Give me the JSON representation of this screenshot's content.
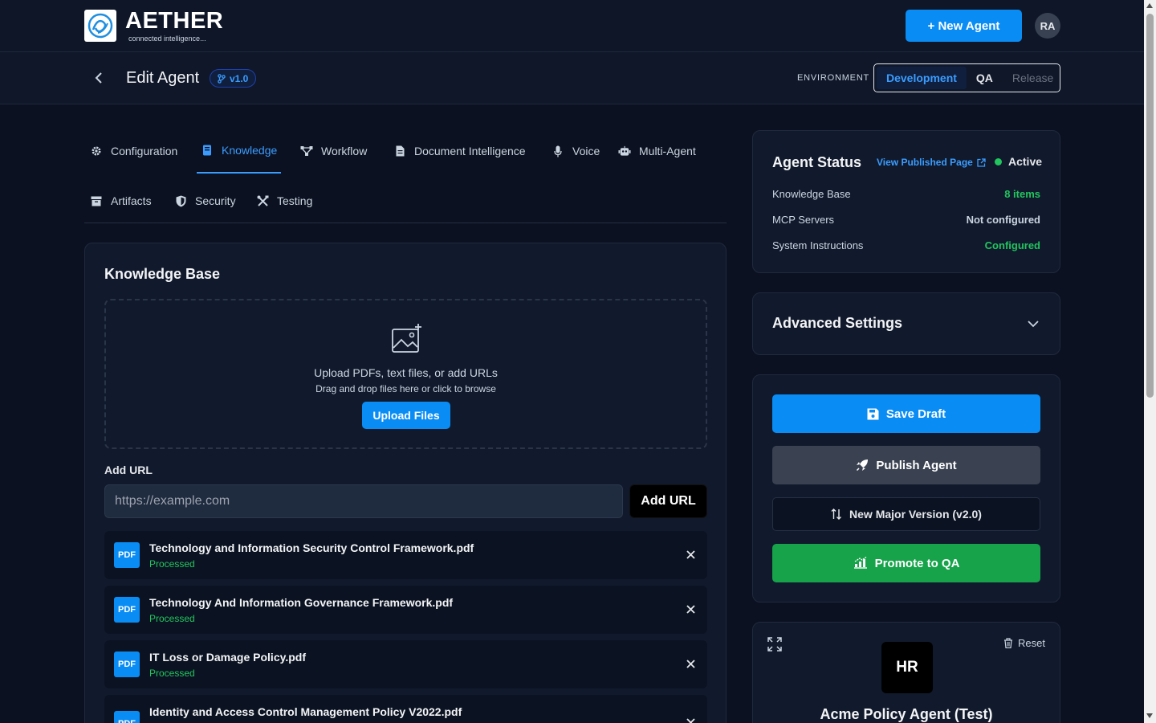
{
  "brand": {
    "name": "AETHER",
    "tagline": "connected intelligence..."
  },
  "topbar": {
    "new_agent_label": "+ New Agent",
    "avatar_initials": "RA"
  },
  "header": {
    "title": "Edit Agent",
    "version": "v1.0",
    "environment_label": "ENVIRONMENT",
    "environments": [
      {
        "label": "Development",
        "state": "active"
      },
      {
        "label": "QA",
        "state": "enabled"
      },
      {
        "label": "Release",
        "state": "disabled"
      }
    ]
  },
  "tabs": [
    {
      "label": "Configuration",
      "icon": "gear-icon"
    },
    {
      "label": "Knowledge",
      "icon": "book-icon",
      "active": true
    },
    {
      "label": "Workflow",
      "icon": "workflow-icon"
    },
    {
      "label": "Document Intelligence",
      "icon": "document-icon"
    },
    {
      "label": "Voice",
      "icon": "microphone-icon"
    },
    {
      "label": "Multi-Agent",
      "icon": "robot-icon"
    },
    {
      "label": "Artifacts",
      "icon": "archive-icon"
    },
    {
      "label": "Security",
      "icon": "shield-icon"
    },
    {
      "label": "Testing",
      "icon": "tools-icon"
    }
  ],
  "knowledge": {
    "title": "Knowledge Base",
    "dropzone_text": "Upload PDFs, text files, or add URLs",
    "dropzone_subtext": "Drag and drop files here or click to browse",
    "upload_label": "Upload Files",
    "url_label": "Add URL",
    "url_placeholder": "https://example.com",
    "add_url_label": "Add URL",
    "files": [
      {
        "badge": "PDF",
        "name": "Technology and Information Security Control Framework.pdf",
        "status": "Processed"
      },
      {
        "badge": "PDF",
        "name": "Technology And Information Governance Framework.pdf",
        "status": "Processed"
      },
      {
        "badge": "PDF",
        "name": "IT Loss or Damage Policy.pdf",
        "status": "Processed"
      },
      {
        "badge": "PDF",
        "name": "Identity and Access Control Management Policy V2022.pdf",
        "status": ""
      }
    ]
  },
  "status": {
    "title": "Agent Status",
    "view_published": "View Published Page",
    "state": "Active",
    "rows": [
      {
        "label": "Knowledge Base",
        "value": "8 items",
        "color": "#22c55e"
      },
      {
        "label": "MCP Servers",
        "value": "Not configured",
        "color": "#cbd5e1"
      },
      {
        "label": "System Instructions",
        "value": "Configured",
        "color": "#22c55e"
      }
    ]
  },
  "advanced": {
    "title": "Advanced Settings"
  },
  "actions": {
    "save_draft": "Save Draft",
    "publish": "Publish Agent",
    "new_major": "New Major Version (v2.0)",
    "promote": "Promote to QA"
  },
  "preview": {
    "reset_label": "Reset",
    "avatar_initials": "HR",
    "agent_name": "Acme Policy Agent (Test)"
  },
  "colors": {
    "accent": "#0a8cf5",
    "success": "#22c55e",
    "promote": "#16a34a",
    "background": "#0b1120"
  }
}
